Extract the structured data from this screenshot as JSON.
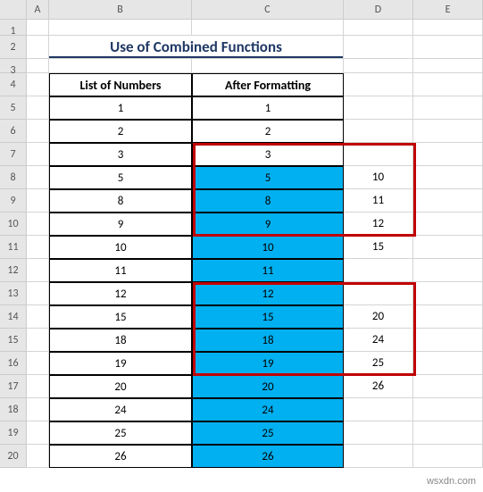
{
  "columns": [
    "A",
    "B",
    "C",
    "D",
    "E"
  ],
  "row_labels": [
    "1",
    "2",
    "3",
    "4",
    "5",
    "6",
    "7",
    "8",
    "9",
    "10",
    "11",
    "12",
    "13",
    "14",
    "15",
    "16",
    "17",
    "18",
    "19",
    "20"
  ],
  "title": "Use of Combined Functions",
  "headers": {
    "b": "List of Numbers",
    "c": "After Formatting"
  },
  "data_b": [
    "1",
    "2",
    "3",
    "5",
    "8",
    "9",
    "10",
    "11",
    "12",
    "15",
    "18",
    "19",
    "20",
    "24",
    "25",
    "26"
  ],
  "data_c": [
    "1",
    "2",
    "3",
    "5",
    "8",
    "9",
    "10",
    "11",
    "12",
    "15",
    "18",
    "19",
    "20",
    "24",
    "25",
    "26"
  ],
  "data_d_block1": [
    "10",
    "11",
    "12",
    "15"
  ],
  "data_d_block2": [
    "20",
    "24",
    "25",
    "26"
  ],
  "highlighted_c_indices": [
    3,
    4,
    5,
    6,
    7,
    8,
    9,
    10,
    11,
    12,
    13,
    14,
    15
  ],
  "watermark": "wsxdn.com",
  "colors": {
    "title": "#1f3864",
    "highlight": "#00b0f0",
    "redbox": "#c00000"
  }
}
